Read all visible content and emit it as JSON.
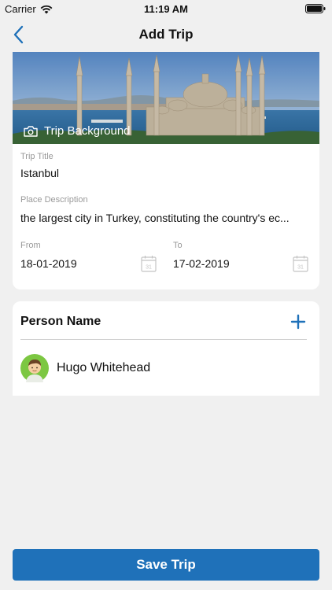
{
  "status_bar": {
    "carrier": "Carrier",
    "time": "11:19 AM"
  },
  "nav": {
    "title": "Add Trip"
  },
  "trip": {
    "background_label": "Trip Background",
    "title_label": "Trip Title",
    "title_value": "Istanbul",
    "description_label": "Place Description",
    "description_value": "the largest city in Turkey, constituting the country's ec...",
    "from_label": "From",
    "from_value": "18-01-2019",
    "to_label": "To",
    "to_value": "17-02-2019",
    "calendar_day": "31"
  },
  "persons": {
    "heading": "Person Name",
    "items": [
      {
        "name": "Hugo Whitehead"
      }
    ]
  },
  "save_label": "Save Trip",
  "colors": {
    "accent": "#1f71b9",
    "background": "#f0f0f0",
    "card": "#ffffff"
  },
  "icons": [
    "wifi-icon",
    "battery-icon",
    "back-chevron-icon",
    "camera-icon",
    "calendar-icon",
    "plus-icon",
    "avatar"
  ]
}
